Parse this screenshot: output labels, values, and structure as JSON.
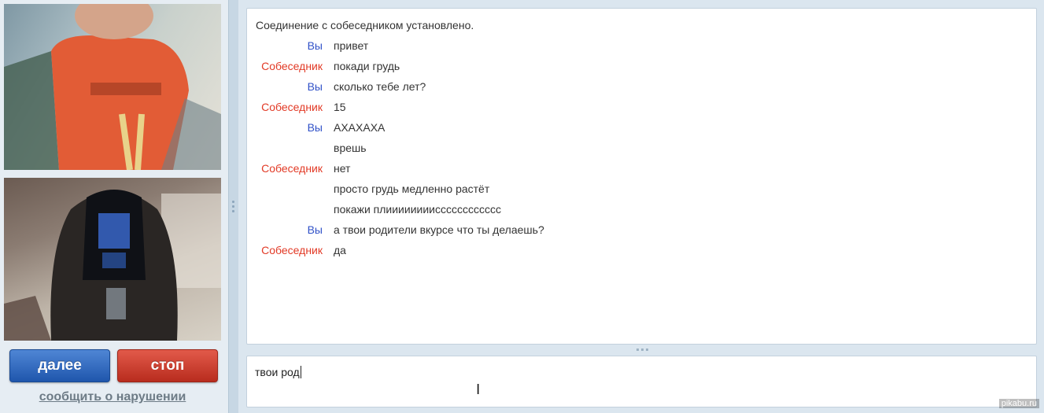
{
  "chat": {
    "system_message": "Соединение с собеседником установлено.",
    "messages": [
      {
        "sender": "Вы",
        "role": "you",
        "text": "привет"
      },
      {
        "sender": "Собеседник",
        "role": "partner",
        "text": "покади грудь"
      },
      {
        "sender": "Вы",
        "role": "you",
        "text": "сколько тебе лет?"
      },
      {
        "sender": "Собеседник",
        "role": "partner",
        "text": "15"
      },
      {
        "sender": "Вы",
        "role": "you",
        "text": "АХАХАХА"
      },
      {
        "sender": "",
        "role": "you",
        "text": "врешь"
      },
      {
        "sender": "Собеседник",
        "role": "partner",
        "text": "нет"
      },
      {
        "sender": "",
        "role": "partner",
        "text": "просто грудь медленно растёт"
      },
      {
        "sender": "",
        "role": "partner",
        "text": "покажи плиииииииисссссссссссс"
      },
      {
        "sender": "Вы",
        "role": "you",
        "text": "а твои родители вкурсе что ты делаешь?"
      },
      {
        "sender": "Собеседник",
        "role": "partner",
        "text": "да"
      }
    ]
  },
  "controls": {
    "next_label": "далее",
    "stop_label": "стоп",
    "report_label": "сообщить о нарушении"
  },
  "input": {
    "value": "твои род"
  },
  "watermark": "pikabu.ru",
  "colors": {
    "you": "#3152c8",
    "partner": "#e23a26",
    "next_button": "#2a63bd",
    "stop_button": "#cc3f30"
  }
}
